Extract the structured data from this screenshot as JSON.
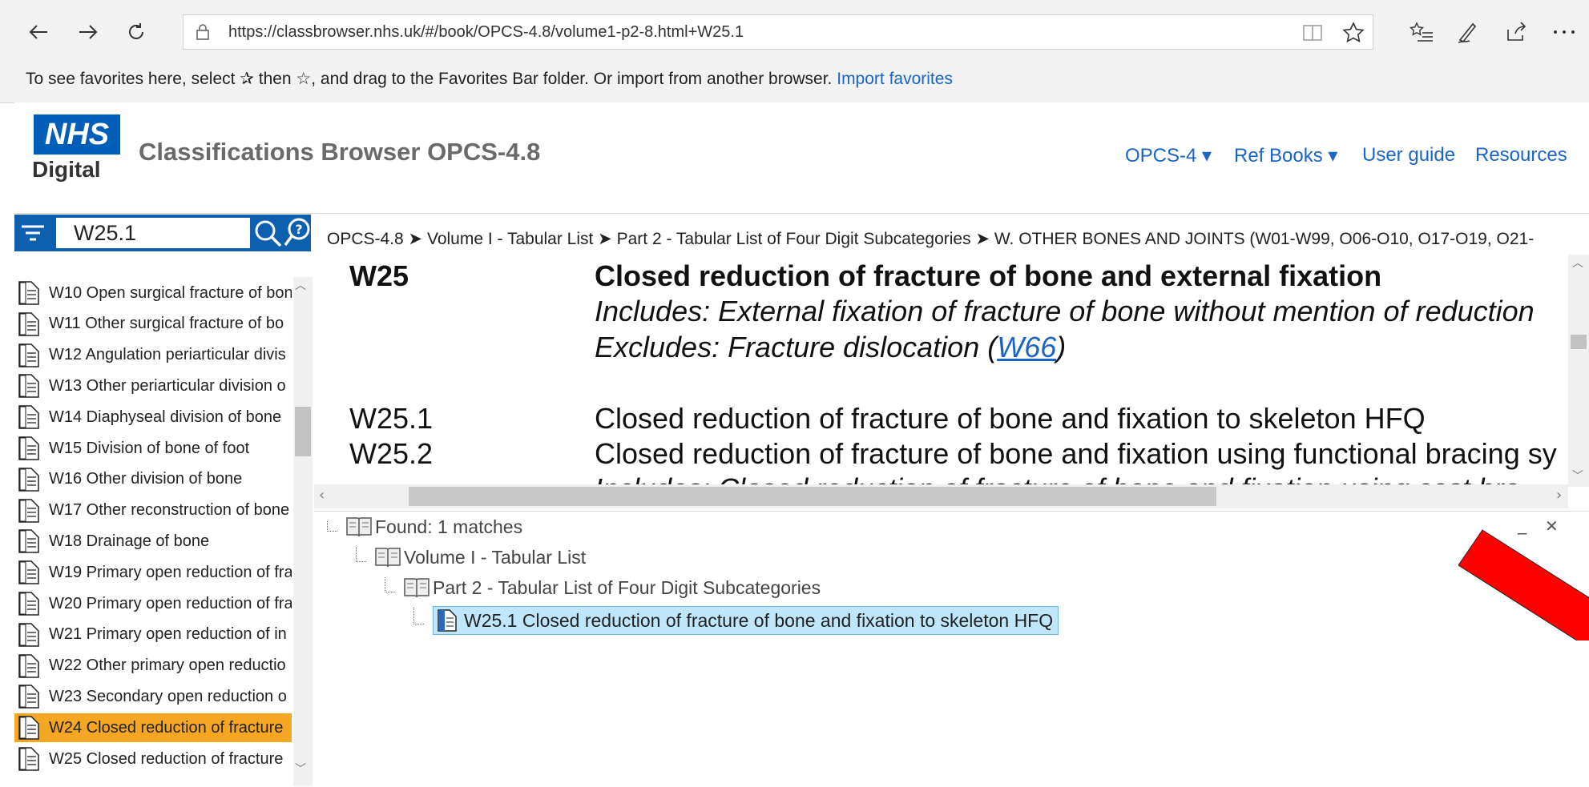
{
  "browser": {
    "url": "https://classbrowser.nhs.uk/#/book/OPCS-4.8/volume1-p2-8.html+W25.1",
    "favorites_text": "To see favorites here, select  ✰  then ☆, and drag to the Favorites Bar folder. Or import from another browser.",
    "import_link": "Import favorites",
    "icons": [
      "back-arrow-icon",
      "forward-arrow-icon",
      "refresh-icon",
      "lock-icon",
      "reading-view-icon",
      "star-icon",
      "favorites-list-icon",
      "pen-icon",
      "share-icon",
      "more-icon"
    ]
  },
  "header": {
    "logo_nhs": "NHS",
    "logo_digital": "Digital",
    "title": "Classifications Browser OPCS-4.8",
    "nav": [
      "OPCS-4 ▾",
      "Ref Books ▾",
      "User guide",
      "Resources"
    ]
  },
  "search": {
    "value": "W25.1"
  },
  "sidebar": {
    "items": [
      {
        "label": "W10 Open surgical fracture of bon"
      },
      {
        "label": "W11 Other surgical fracture of bo"
      },
      {
        "label": "W12 Angulation periarticular divis"
      },
      {
        "label": "W13 Other periarticular division o"
      },
      {
        "label": "W14 Diaphyseal division of bone "
      },
      {
        "label": "W15 Division of bone of foot"
      },
      {
        "label": "W16 Other division of bone"
      },
      {
        "label": "W17 Other reconstruction of bone"
      },
      {
        "label": "W18 Drainage of bone"
      },
      {
        "label": "W19 Primary open reduction of fra"
      },
      {
        "label": "W20 Primary open reduction of fra"
      },
      {
        "label": "W21 Primary open reduction of in"
      },
      {
        "label": "W22 Other primary open reductio"
      },
      {
        "label": "W23 Secondary open reduction o"
      },
      {
        "label": "W24 Closed reduction of fracture ",
        "selected": true
      },
      {
        "label": "W25 Closed reduction of fracture "
      }
    ],
    "selected_color": "#f5a623"
  },
  "breadcrumb": "OPCS-4.8 ➤ Volume I - Tabular List ➤ Part 2 - Tabular List of Four Digit Subcategories ➤ W. OTHER BONES AND JOINTS (W01-W99, O06-O10, O17-O19, O21-",
  "content": {
    "w25_code": "W25",
    "w25_title": "Closed reduction of fracture of bone and external fixation",
    "includes": " Includes: External fixation of fracture of bone without mention of reduction",
    "excludes_pre": "Excludes: Fracture dislocation (",
    "excludes_link": "W66",
    "excludes_post": ")",
    "w251_code": "W25.1",
    "w251_desc": "Closed reduction of fracture of bone and fixation to skeleton HFQ",
    "w252_code": "W25.2",
    "w252_desc": "Closed reduction of fracture of bone and fixation using functional bracing sy",
    "w252_includes": " Includes: Closed reduction of fracture of bone and fixation using cast bra"
  },
  "results": {
    "found": "Found: 1 matches",
    "volume": "Volume I - Tabular List",
    "part": "Part 2 - Tabular List of Four Digit Subcategories",
    "match": "W25.1 Closed reduction of fracture of bone and fixation to skeleton HFQ",
    "minimize": "_",
    "close": "✕"
  },
  "colors": {
    "nhs_blue": "#005eb8",
    "search_bar": "#0d5fb0",
    "link": "#1a64c8",
    "highlight": "#bfe6fb",
    "annotation_arrow": "#ff0000"
  }
}
